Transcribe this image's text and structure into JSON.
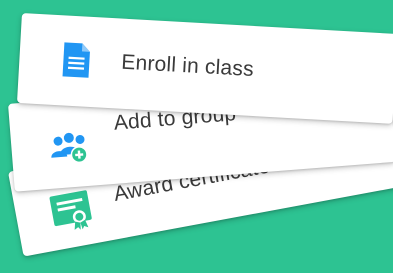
{
  "background_color": "#2dc392",
  "actions": [
    {
      "label": "Award certificate",
      "icon": "certificate-icon",
      "icon_color": "#2dc392"
    },
    {
      "label": "Add to group",
      "icon": "add-group-icon",
      "icon_color": "#2196f3"
    },
    {
      "label": "Enroll in class",
      "icon": "document-icon",
      "icon_color": "#2196f3"
    }
  ]
}
